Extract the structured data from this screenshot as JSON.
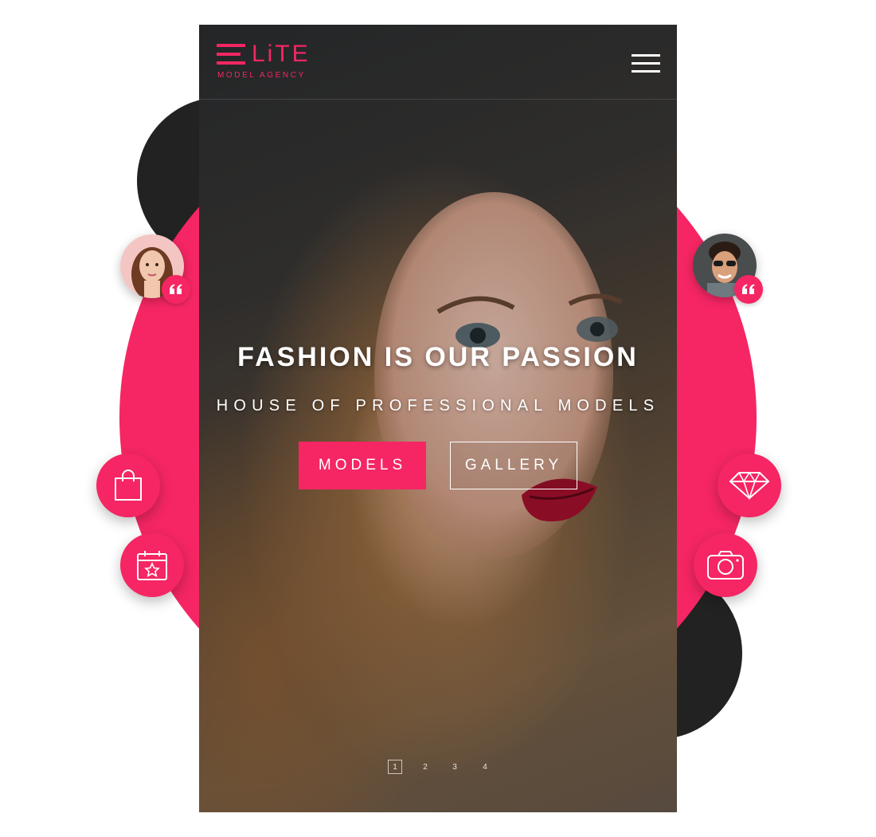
{
  "brand": {
    "name": "LiTE",
    "tagline": "MODEL AGENCY",
    "accent_color": "#f52663",
    "dark_color": "#222222"
  },
  "header": {
    "menu_icon": "hamburger-menu-icon"
  },
  "hero": {
    "title": "FASHION IS OUR PASSION",
    "subtitle": "HOUSE OF PROFESSIONAL MODELS",
    "buttons": {
      "models": "MODELS",
      "gallery": "GALLERY"
    }
  },
  "pagination": {
    "pages": [
      "1",
      "2",
      "3",
      "4"
    ],
    "active": "1"
  },
  "floating_icons": {
    "left": [
      "shopping-bag-icon",
      "calendar-star-icon"
    ],
    "right": [
      "diamond-icon",
      "camera-icon"
    ],
    "testimonials": [
      "quote-icon",
      "quote-icon"
    ]
  }
}
